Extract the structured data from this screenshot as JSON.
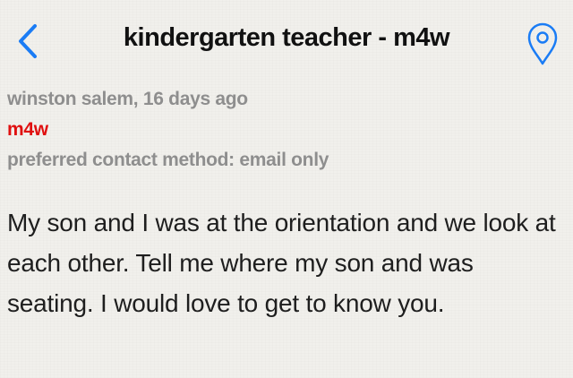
{
  "nav": {
    "back_icon": "chevron-left-icon",
    "title": "kindergarten teacher - m4w",
    "map_icon": "map-pin-icon",
    "accent_color": "#1a7cf5"
  },
  "meta": {
    "location_age": "winston salem, 16 days ago",
    "category": "m4w",
    "category_color": "#e01010",
    "contact_method": "preferred contact method: email only"
  },
  "post": {
    "body": "My son and I was at the orientation and we look at each other. Tell me where my son and was seating. I would love to get to know you."
  }
}
